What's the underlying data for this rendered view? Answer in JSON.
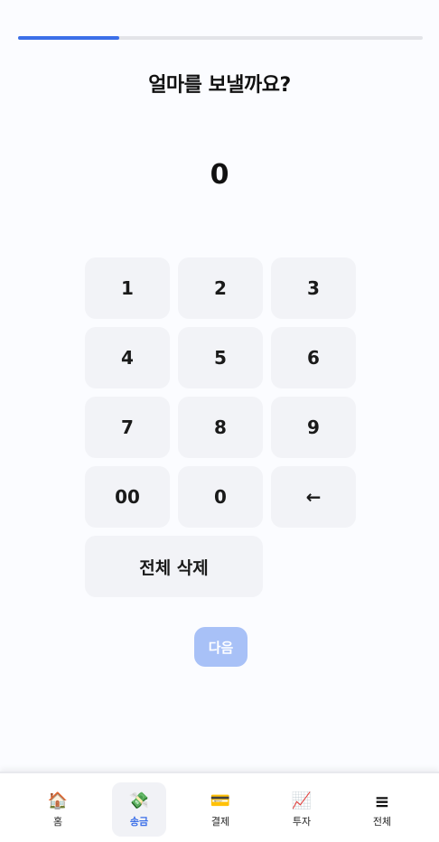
{
  "progress": {
    "value": 0.25
  },
  "title": "얼마를 보낼까요?",
  "amount": "0",
  "keypad": {
    "keys": [
      "1",
      "2",
      "3",
      "4",
      "5",
      "6",
      "7",
      "8",
      "9",
      "00",
      "0",
      "←"
    ],
    "clear_all_label": "전체 삭제"
  },
  "next_button": {
    "label": "다음"
  },
  "bottom_nav": {
    "items": [
      {
        "label": "홈",
        "icon": "🏠",
        "icon_name": "home-icon"
      },
      {
        "label": "송금",
        "icon": "💸",
        "icon_name": "money-transfer-icon",
        "active": true
      },
      {
        "label": "결제",
        "icon": "💳",
        "icon_name": "credit-card-icon"
      },
      {
        "label": "투자",
        "icon": "📈",
        "icon_name": "chart-increasing-icon"
      },
      {
        "label": "전체",
        "icon": "≡",
        "icon_name": "menu-icon"
      }
    ]
  },
  "colors": {
    "accent": "#3b6fe8",
    "next_button_disabled": "#a8c1f7",
    "key_background": "#f2f3f7"
  }
}
